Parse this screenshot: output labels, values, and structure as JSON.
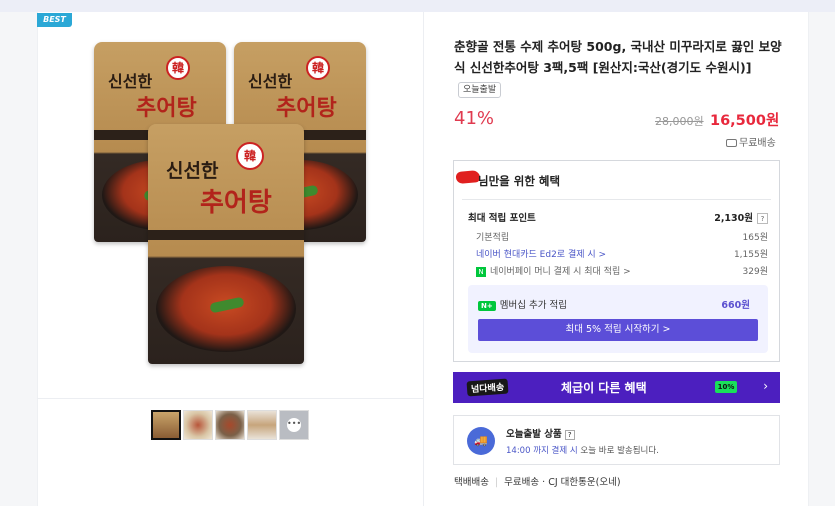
{
  "badge": "BEST",
  "packaging": {
    "brand_top": "신선한",
    "brand_main": "추어탕",
    "seal": "韓"
  },
  "product": {
    "title": "춘향골 전통 수제 추어탕 500g, 국내산 미꾸라지로 끓인 보양식 신선한추어탕 3팩,5팩 [원산지:국산(경기도 수원시)]",
    "today_tag": "오늘출발",
    "discount": "41%",
    "original_price": "28,000원",
    "price": "16,500원",
    "shipping": "무료배송"
  },
  "benefits": {
    "title": "님만을 위한 혜택",
    "max_points_label": "최대 적립 포인트",
    "max_points_value": "2,130원",
    "help": "?",
    "rows": [
      {
        "label": "기본적립",
        "value": "165원"
      },
      {
        "label": "네이버 현대카드 Ed2로 결제 시 >",
        "value": "1,155원"
      },
      {
        "label": "네이버페이 머니 결제 시 최대 적립 >",
        "value": "329원",
        "badge": "N"
      }
    ],
    "membership_badge": "N+",
    "membership_label": "멤버십 추가 적립",
    "membership_value": "660원",
    "membership_button": "최대 5% 적립 시작하기 >"
  },
  "banner": {
    "logo": "넘다배송",
    "text": "체급이 다른 혜택",
    "pill": "10%",
    "chevron": "›"
  },
  "today_ship": {
    "icon": "🚚",
    "title": "오늘출발 상품",
    "help": "?",
    "desc_highlight": "14:00 까지 결제 시",
    "desc_rest": " 오늘 바로 발송됩니다."
  },
  "delivery": {
    "type": "택배배송",
    "fee": "무료배송",
    "carrier": "· CJ 대한통운(오네)"
  },
  "thumb_more": "•••",
  "colors": {
    "accent_red": "#e8283c",
    "purple": "#5c4ed8",
    "banner": "#4c1fbf",
    "npay_green": "#00c73c"
  }
}
